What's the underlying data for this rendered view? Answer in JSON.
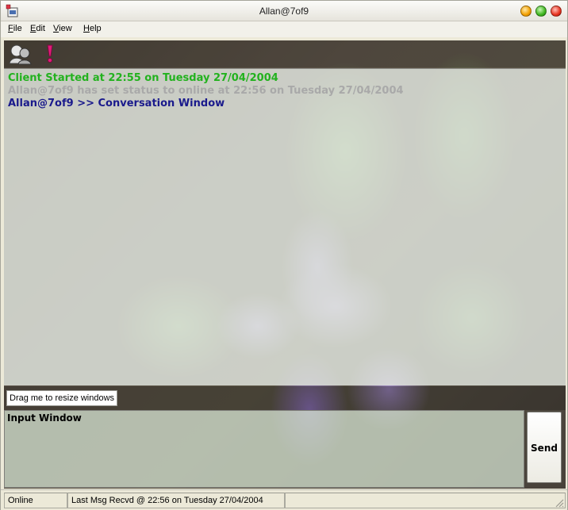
{
  "window": {
    "title": "Allan@7of9"
  },
  "menu": {
    "items": [
      {
        "key": "F",
        "rest": "ile"
      },
      {
        "key": "E",
        "rest": "dit"
      },
      {
        "key": "V",
        "rest": "iew"
      },
      {
        "key": "H",
        "rest": "elp"
      }
    ]
  },
  "toolbar": {
    "icons": [
      "contact-icon",
      "alert-icon"
    ]
  },
  "conversation": {
    "lines": [
      {
        "text": "Client Started at 22:55 on Tuesday 27/04/2004",
        "color": "#22b21e"
      },
      {
        "text": "Allan@7of9 has set status to online at 22:56 on Tuesday 27/04/2004",
        "color": "#a9a9a9"
      },
      {
        "text": "Allan@7of9 >> Conversation Window",
        "color": "#1a1a8c"
      }
    ]
  },
  "resize_handle": {
    "label": "Drag me to resize windows"
  },
  "input": {
    "label": "Input Window",
    "value": ""
  },
  "send_button": {
    "label": "Send"
  },
  "status": {
    "state": "Online",
    "last_message": "Last Msg Recvd @ 22:56 on Tuesday 27/04/2004",
    "extra": ""
  }
}
